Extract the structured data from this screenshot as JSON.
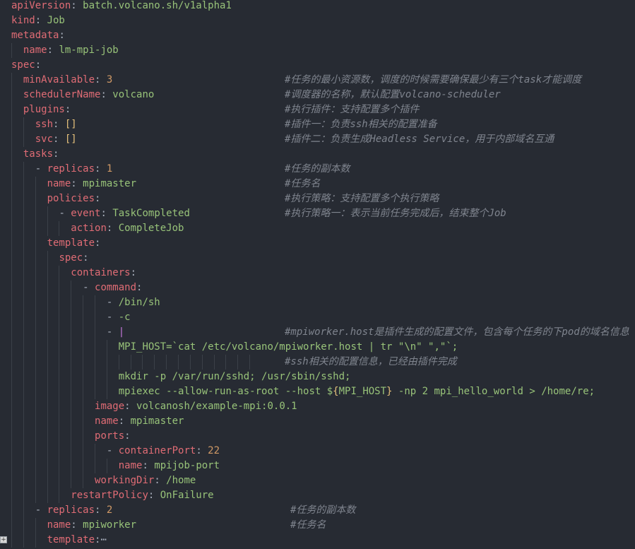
{
  "lines": [
    {
      "indent": 0,
      "tokens": [
        {
          "t": "apiVersion",
          "c": "k"
        },
        {
          "t": ": ",
          "c": "p"
        },
        {
          "t": "batch.volcano.sh/v1alpha1",
          "c": "s"
        }
      ]
    },
    {
      "indent": 0,
      "tokens": [
        {
          "t": "kind",
          "c": "k"
        },
        {
          "t": ": ",
          "c": "p"
        },
        {
          "t": "Job",
          "c": "s"
        }
      ]
    },
    {
      "indent": 0,
      "tokens": [
        {
          "t": "metadata",
          "c": "k"
        },
        {
          "t": ":",
          "c": "p"
        }
      ]
    },
    {
      "indent": 1,
      "tokens": [
        {
          "t": "name",
          "c": "k"
        },
        {
          "t": ": ",
          "c": "p"
        },
        {
          "t": "lm-mpi-job",
          "c": "s"
        }
      ]
    },
    {
      "indent": 0,
      "tokens": [
        {
          "t": "spec",
          "c": "k"
        },
        {
          "t": ":",
          "c": "p"
        }
      ]
    },
    {
      "indent": 1,
      "tokens": [
        {
          "t": "minAvailable",
          "c": "k"
        },
        {
          "t": ": ",
          "c": "p"
        },
        {
          "t": "3",
          "c": "n"
        }
      ],
      "comment": "#任务的最小资源数，调度的时候需要确保最少有三个task才能调度"
    },
    {
      "indent": 1,
      "tokens": [
        {
          "t": "schedulerName",
          "c": "k"
        },
        {
          "t": ": ",
          "c": "p"
        },
        {
          "t": "volcano",
          "c": "s"
        }
      ],
      "comment": "#调度器的名称，默认配置volcano-scheduler"
    },
    {
      "indent": 1,
      "tokens": [
        {
          "t": "plugins",
          "c": "k"
        },
        {
          "t": ":",
          "c": "p"
        }
      ],
      "comment": "#执行插件：支持配置多个插件"
    },
    {
      "indent": 2,
      "tokens": [
        {
          "t": "ssh",
          "c": "k"
        },
        {
          "t": ": ",
          "c": "p"
        },
        {
          "t": "[]",
          "c": "b"
        }
      ],
      "comment": "#插件一：负责ssh相关的配置准备"
    },
    {
      "indent": 2,
      "tokens": [
        {
          "t": "svc",
          "c": "k"
        },
        {
          "t": ": ",
          "c": "p"
        },
        {
          "t": "[]",
          "c": "b"
        }
      ],
      "comment": "#插件二：负责生成Headless Service，用于内部域名互通"
    },
    {
      "indent": 1,
      "tokens": [
        {
          "t": "tasks",
          "c": "k"
        },
        {
          "t": ":",
          "c": "p"
        }
      ]
    },
    {
      "indent": 2,
      "tokens": [
        {
          "t": "- ",
          "c": "p"
        },
        {
          "t": "replicas",
          "c": "k"
        },
        {
          "t": ": ",
          "c": "p"
        },
        {
          "t": "1",
          "c": "n"
        }
      ],
      "comment": "#任务的副本数"
    },
    {
      "indent": 3,
      "tokens": [
        {
          "t": "name",
          "c": "k"
        },
        {
          "t": ": ",
          "c": "p"
        },
        {
          "t": "mpimaster",
          "c": "s"
        }
      ],
      "comment": "#任务名"
    },
    {
      "indent": 3,
      "tokens": [
        {
          "t": "policies",
          "c": "k"
        },
        {
          "t": ":",
          "c": "p"
        }
      ],
      "comment": "#执行策略：支持配置多个执行策略"
    },
    {
      "indent": 4,
      "tokens": [
        {
          "t": "- ",
          "c": "p"
        },
        {
          "t": "event",
          "c": "k"
        },
        {
          "t": ": ",
          "c": "p"
        },
        {
          "t": "TaskCompleted",
          "c": "s"
        }
      ],
      "comment": "#执行策略一：表示当前任务完成后，结束整个Job"
    },
    {
      "indent": 5,
      "tokens": [
        {
          "t": "action",
          "c": "k"
        },
        {
          "t": ": ",
          "c": "p"
        },
        {
          "t": "CompleteJob",
          "c": "s"
        }
      ]
    },
    {
      "indent": 3,
      "tokens": [
        {
          "t": "template",
          "c": "k"
        },
        {
          "t": ":",
          "c": "p"
        }
      ]
    },
    {
      "indent": 4,
      "tokens": [
        {
          "t": "spec",
          "c": "k"
        },
        {
          "t": ":",
          "c": "p"
        }
      ]
    },
    {
      "indent": 5,
      "tokens": [
        {
          "t": "containers",
          "c": "k"
        },
        {
          "t": ":",
          "c": "p"
        }
      ]
    },
    {
      "indent": 6,
      "tokens": [
        {
          "t": "- ",
          "c": "p"
        },
        {
          "t": "command",
          "c": "k"
        },
        {
          "t": ":",
          "c": "p"
        }
      ]
    },
    {
      "indent": 8,
      "tokens": [
        {
          "t": "- ",
          "c": "p"
        },
        {
          "t": "/bin/sh",
          "c": "s"
        }
      ]
    },
    {
      "indent": 8,
      "tokens": [
        {
          "t": "- ",
          "c": "p"
        },
        {
          "t": "-c",
          "c": "s"
        }
      ]
    },
    {
      "indent": 8,
      "tokens": [
        {
          "t": "- ",
          "c": "p"
        },
        {
          "t": "|",
          "c": "h"
        }
      ],
      "comment": "#mpiworker.host是插件生成的配置文件，包含每个任务的下pod的域名信息"
    },
    {
      "indent": 9,
      "tokens": [
        {
          "t": "MPI_HOST=`cat /etc/volcano/mpiworker.host | tr \"\\n\" \",\"`;",
          "c": "s"
        }
      ]
    },
    {
      "indent": 9,
      "tokens": [],
      "comment": "#ssh相关的配置信息，已经由插件完成",
      "guide_extra": true
    },
    {
      "indent": 9,
      "tokens": [
        {
          "t": "mkdir -p /var/run/sshd; /usr/sbin/sshd;",
          "c": "s"
        }
      ]
    },
    {
      "indent": 9,
      "tokens": [
        {
          "t": "mpiexec --allow-run-as-root --host $",
          "c": "s"
        },
        {
          "t": "{",
          "c": "b"
        },
        {
          "t": "MPI_HOST",
          "c": "s"
        },
        {
          "t": "}",
          "c": "b"
        },
        {
          "t": " -np 2 mpi_hello_world > /home/re;",
          "c": "s"
        }
      ]
    },
    {
      "indent": 7,
      "tokens": [
        {
          "t": "image",
          "c": "k"
        },
        {
          "t": ": ",
          "c": "p"
        },
        {
          "t": "volcanosh/example-mpi:0.0.1",
          "c": "s"
        }
      ]
    },
    {
      "indent": 7,
      "tokens": [
        {
          "t": "name",
          "c": "k"
        },
        {
          "t": ": ",
          "c": "p"
        },
        {
          "t": "mpimaster",
          "c": "s"
        }
      ]
    },
    {
      "indent": 7,
      "tokens": [
        {
          "t": "ports",
          "c": "k"
        },
        {
          "t": ":",
          "c": "p"
        }
      ]
    },
    {
      "indent": 8,
      "tokens": [
        {
          "t": "- ",
          "c": "p"
        },
        {
          "t": "containerPort",
          "c": "k"
        },
        {
          "t": ": ",
          "c": "p"
        },
        {
          "t": "22",
          "c": "n"
        }
      ]
    },
    {
      "indent": 9,
      "tokens": [
        {
          "t": "name",
          "c": "k"
        },
        {
          "t": ": ",
          "c": "p"
        },
        {
          "t": "mpijob-port",
          "c": "s"
        }
      ]
    },
    {
      "indent": 7,
      "tokens": [
        {
          "t": "workingDir",
          "c": "k"
        },
        {
          "t": ": ",
          "c": "p"
        },
        {
          "t": "/home",
          "c": "s"
        }
      ]
    },
    {
      "indent": 5,
      "tokens": [
        {
          "t": "restartPolicy",
          "c": "k"
        },
        {
          "t": ": ",
          "c": "p"
        },
        {
          "t": "OnFailure",
          "c": "s"
        }
      ]
    },
    {
      "indent": 2,
      "tokens": [
        {
          "t": "- ",
          "c": "p"
        },
        {
          "t": "replicas",
          "c": "k"
        },
        {
          "t": ": ",
          "c": "p"
        },
        {
          "t": "2",
          "c": "n"
        }
      ],
      "comment": "#任务的副本数",
      "comment_shift": 1
    },
    {
      "indent": 3,
      "tokens": [
        {
          "t": "name",
          "c": "k"
        },
        {
          "t": ": ",
          "c": "p"
        },
        {
          "t": "mpiworker",
          "c": "s"
        }
      ],
      "comment": "#任务名",
      "comment_shift": 1
    },
    {
      "indent": 3,
      "tokens": [
        {
          "t": "template",
          "c": "k"
        },
        {
          "t": ":",
          "c": "p"
        },
        {
          "t": "⋯",
          "c": "p"
        }
      ]
    }
  ],
  "fold_marker": "+"
}
